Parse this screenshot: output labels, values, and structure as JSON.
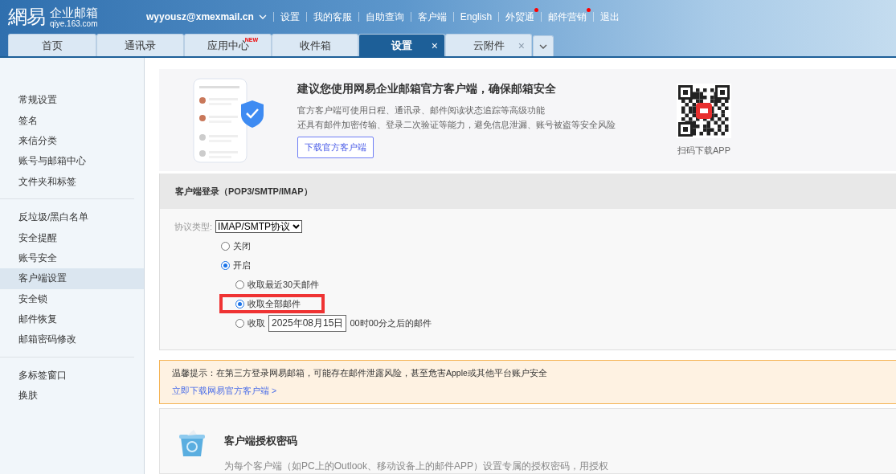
{
  "header": {
    "logo": {
      "mark": "網易",
      "name": "企业邮箱",
      "domain": "qiye.163.com"
    },
    "account": "wyyousz@xmexmail.cn",
    "nav": [
      {
        "label": "设置",
        "dot": false
      },
      {
        "label": "我的客服",
        "dot": false
      },
      {
        "label": "自助查询",
        "dot": false
      },
      {
        "label": "客户端",
        "dot": false
      },
      {
        "label": "English",
        "dot": false
      },
      {
        "label": "外贸通",
        "dot": true
      },
      {
        "label": "邮件营销",
        "dot": true
      },
      {
        "label": "退出",
        "dot": false
      }
    ]
  },
  "tabs": [
    {
      "label": "首页",
      "selected": false
    },
    {
      "label": "通讯录",
      "selected": false
    },
    {
      "label": "应用中心",
      "selected": false,
      "badge": "NEW"
    },
    {
      "label": "收件箱",
      "selected": false
    },
    {
      "label": "设置",
      "selected": true,
      "close": "×"
    },
    {
      "label": "云附件",
      "selected": false,
      "close": "×"
    }
  ],
  "sidebar": {
    "groups": [
      {
        "items": [
          {
            "label": "常规设置",
            "selected": false
          },
          {
            "label": "签名",
            "selected": false
          },
          {
            "label": "来信分类",
            "selected": false
          },
          {
            "label": "账号与邮箱中心",
            "selected": false
          },
          {
            "label": "文件夹和标签",
            "selected": false
          }
        ]
      },
      {
        "items": [
          {
            "label": "反垃圾/黑白名单",
            "selected": false
          },
          {
            "label": "安全提醒",
            "selected": false
          },
          {
            "label": "账号安全",
            "selected": false
          },
          {
            "label": "客户端设置",
            "selected": true
          },
          {
            "label": "安全锁",
            "selected": false
          },
          {
            "label": "邮件恢复",
            "selected": false
          },
          {
            "label": "邮箱密码修改",
            "selected": false
          }
        ]
      },
      {
        "items": [
          {
            "label": "多标签窗口",
            "selected": false
          },
          {
            "label": "换肤",
            "selected": false
          }
        ]
      }
    ]
  },
  "banner": {
    "title": "建议您使用网易企业邮箱官方客户端，确保邮箱安全",
    "lines": [
      "官方客户端可使用日程、通讯录、邮件阅读状态追踪等高级功能",
      "还具有邮件加密传输、登录二次验证等能力，避免信息泄漏、账号被盗等安全风险"
    ],
    "button": "下载官方客户端",
    "qr_caption": "扫码下载APP"
  },
  "client_login": {
    "title": "客户端登录（POP3/SMTP/IMAP）",
    "protocol_label": "协议类型:",
    "protocol_value": "IMAP/SMTP协议",
    "options": [
      {
        "kind": "plain",
        "label": "关闭",
        "selected": false
      },
      {
        "kind": "plain",
        "label": "开启",
        "selected": true,
        "children": [
          {
            "kind": "plain",
            "label": "收取最近30天邮件",
            "selected": false,
            "highlighted": false
          },
          {
            "kind": "plain",
            "label": "收取全部邮件",
            "selected": true,
            "highlighted": true
          },
          {
            "kind": "date",
            "label": "收取",
            "date": "2025年08月15日",
            "suffix": "00时00分之后的邮件",
            "selected": false,
            "highlighted": false
          }
        ]
      }
    ]
  },
  "notice": {
    "text": "温馨提示：在第三方登录网易邮箱，可能存在邮件泄露风险，甚至危害Apple或其他平台账户安全",
    "link": "立即下载网易官方客户端 >"
  },
  "auth_card": {
    "title": "客户端授权密码",
    "description": "为每个客户端（如PC上的Outlook、移动设备上的邮件APP）设置专属的授权密码，用授权"
  }
}
